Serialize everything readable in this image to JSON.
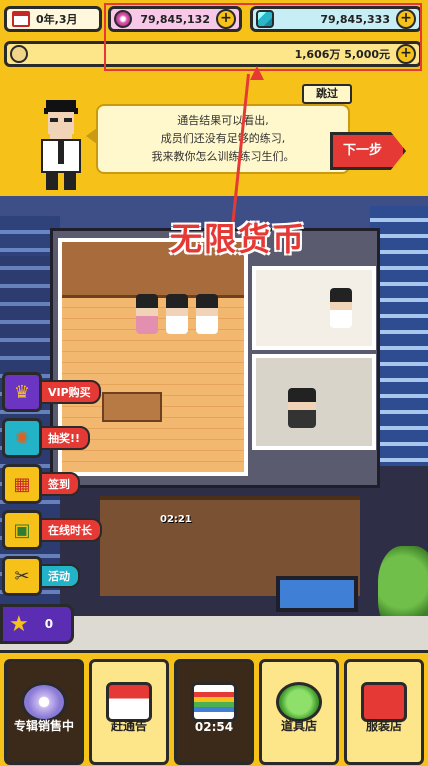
{
  "hud": {
    "date": "0年,3月",
    "gems": "79,845,132",
    "coins": "79,845,333",
    "cash": "1,606万 5,000元",
    "skip_label": "跳过",
    "dialog_lines": [
      "通告结果可以看出,",
      "成员们还没有足够的练习,",
      "我来教你怎么训练练习生们。"
    ],
    "next_label": "下一步"
  },
  "annotation": {
    "text": "无限货币",
    "color": "#e53935"
  },
  "scene": {
    "timer": "02:21"
  },
  "side_menu": [
    {
      "label": "VIP购买",
      "icon": "crown-icon",
      "color": "#e53935"
    },
    {
      "label": "抽奖!!",
      "icon": "lottery-icon",
      "color": "#e53935"
    },
    {
      "label": "签到",
      "icon": "calendar-icon",
      "color": "#e53935"
    },
    {
      "label": "在线时长",
      "icon": "gift-icon",
      "color": "#e53935"
    },
    {
      "label": "活动",
      "icon": "scissors-icon",
      "color": "#22b3c9"
    }
  ],
  "stars": "0",
  "bottom_tabs": [
    {
      "label": "专辑销售中",
      "icon": "disc-icon",
      "dark": true
    },
    {
      "label": "赶通告",
      "icon": "calendar-icon",
      "dark": false
    },
    {
      "label": "02:54",
      "icon": "rainbow-icon",
      "dark": true
    },
    {
      "label": "道具店",
      "icon": "clover-icon",
      "dark": false
    },
    {
      "label": "服装店",
      "icon": "shirt-icon",
      "dark": false
    }
  ]
}
